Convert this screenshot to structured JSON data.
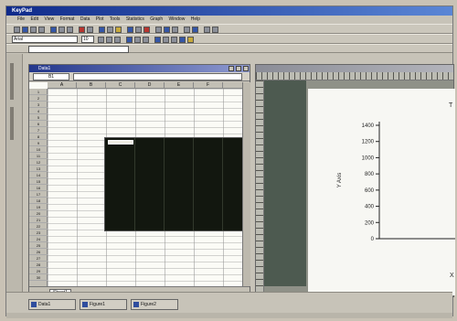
{
  "app": {
    "title": "KeyPad",
    "menu": [
      "File",
      "Edit",
      "View",
      "Format",
      "Data",
      "Plot",
      "Tools",
      "Statistics",
      "Graph",
      "Window",
      "Help"
    ]
  },
  "toolbar": {
    "font_name": "Arial",
    "font_size": "10"
  },
  "worksheet": {
    "title": "Data1",
    "cell_ref": "B1",
    "formula": "",
    "columns": [
      "A",
      "B",
      "C",
      "D",
      "E",
      "F"
    ],
    "rows": [
      "1",
      "2",
      "3",
      "4",
      "5",
      "6",
      "7",
      "8",
      "9",
      "10",
      "11",
      "12",
      "13",
      "14",
      "15",
      "16",
      "17",
      "18",
      "19",
      "20",
      "21",
      "22",
      "23",
      "24",
      "25",
      "26",
      "27",
      "28",
      "29",
      "30"
    ],
    "tab_label": "Sheet1"
  },
  "graph": {
    "y_axis_label": "Y Axis",
    "x_axis_label": "X",
    "y_ticks": [
      "0",
      "200",
      "400",
      "600",
      "800",
      "1000",
      "1200",
      "1400"
    ],
    "top_right_char": "T"
  },
  "taskbar": {
    "items": [
      "Data1",
      "Figure1",
      "Figure2"
    ]
  }
}
